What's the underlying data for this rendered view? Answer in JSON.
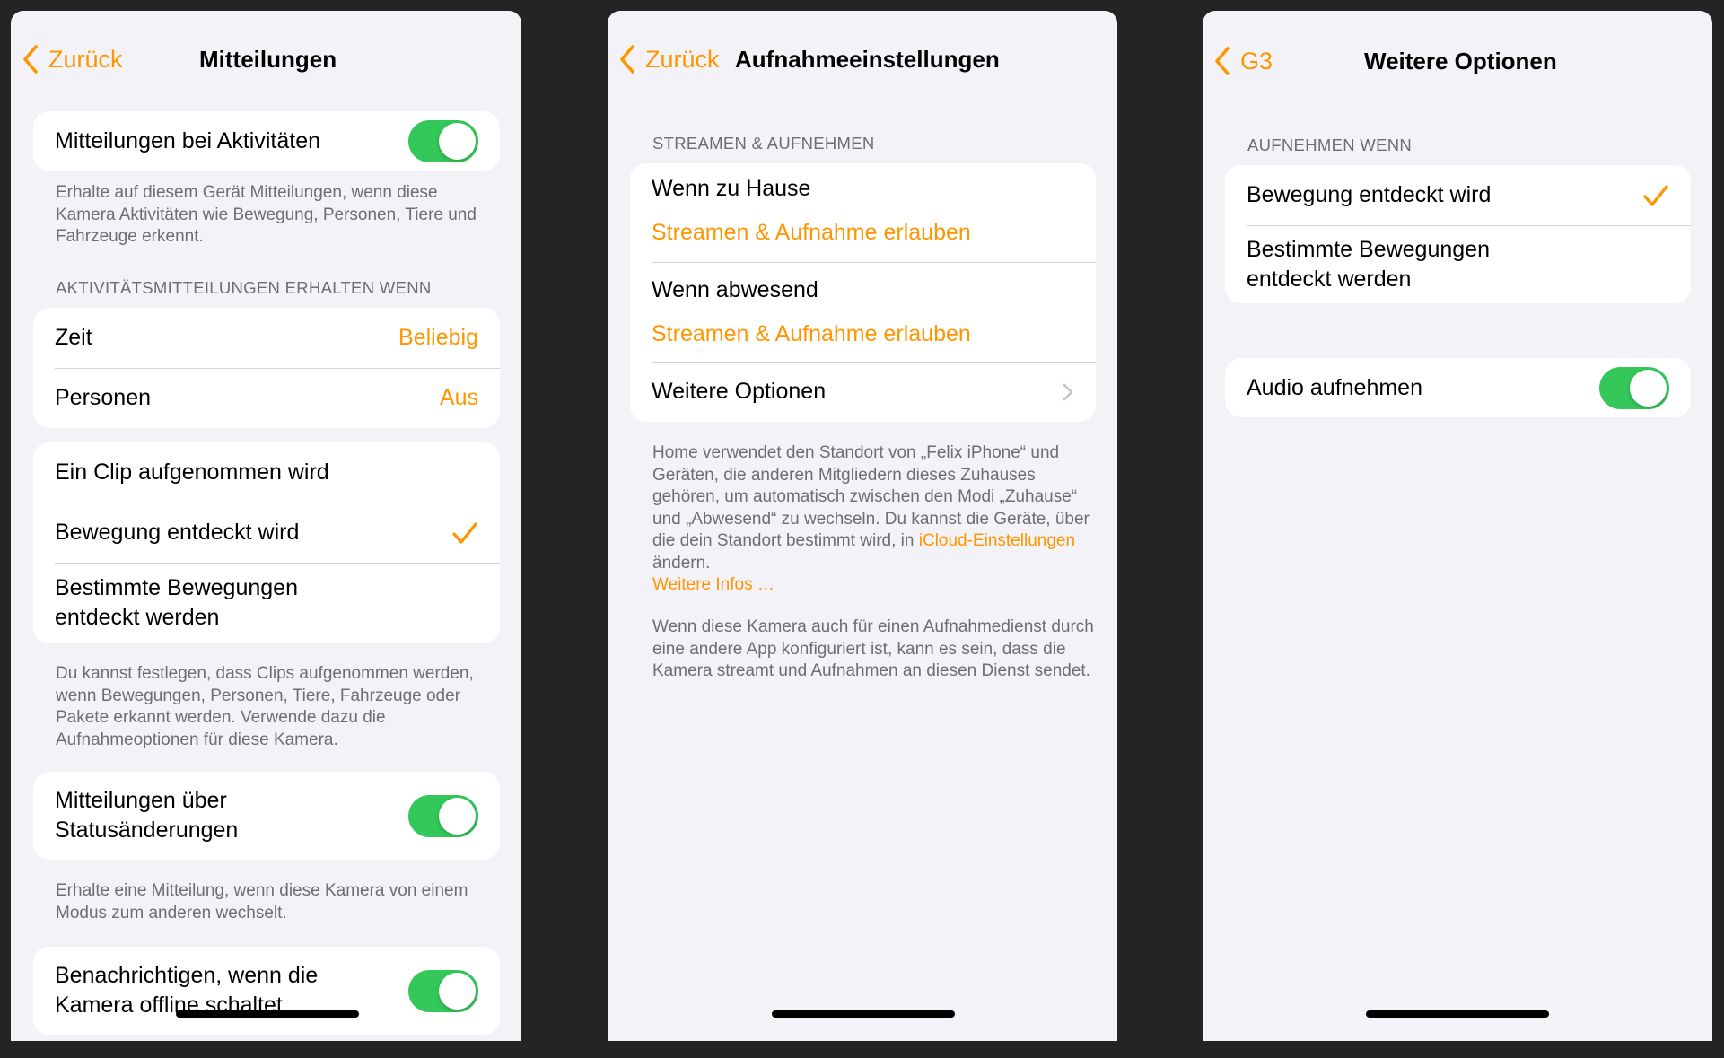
{
  "screen1": {
    "back_label": "Zurück",
    "title": "Mitteilungen",
    "activity_toggle_label": "Mitteilungen bei Aktivitäten",
    "activity_footnote": "Erhalte auf diesem Gerät Mitteilungen, wenn diese Kamera Aktivitäten wie Bewegung, Personen, Tiere und Fahrzeuge erkennt.",
    "section_when": "AKTIVITÄTSMITTEILUNGEN ERHALTEN WENN",
    "time_label": "Zeit",
    "time_value": "Beliebig",
    "persons_label": "Personen",
    "persons_value": "Aus",
    "clip_option": "Ein Clip aufgenommen wird",
    "motion_option": "Bewegung entdeckt wird",
    "specific_motion_line1": "Bestimmte Bewegungen",
    "specific_motion_line2": "entdeckt werden",
    "clips_footnote": "Du kannst festlegen, dass Clips aufgenommen werden, wenn Bewegungen, Personen, Tiere, Fahrzeuge oder Pakete erkannt werden. Verwende dazu die Aufnahmeoptionen für diese Kamera.",
    "status_line1": "Mitteilungen über",
    "status_line2": "Statusänderungen",
    "status_footnote": "Erhalte eine Mitteilung, wenn diese Kamera von einem Modus zum anderen wechselt.",
    "offline_line1": "Benachrichtigen, wenn die",
    "offline_line2": "Kamera offline schaltet"
  },
  "screen2": {
    "back_label": "Zurück",
    "title": "Aufnahmeeinstellungen",
    "section": "STREAMEN & AUFNEHMEN",
    "home_label": "Wenn zu Hause",
    "home_value": "Streamen & Aufnahme erlauben",
    "away_label": "Wenn abwesend",
    "away_value": "Streamen & Aufnahme erlauben",
    "more_options": "Weitere Optionen",
    "footnote_text": "Home verwendet den Standort von „Felix iPhone“ und Geräten, die anderen Mitgliedern dieses Zuhauses gehören, um automatisch zwischen den Modi „Zuhause“ und „Abwesend“ zu wechseln. Du kannst die Geräte, über die dein Standort bestimmt wird, in",
    "footnote_link": "iCloud-Einstellungen",
    "footnote_after": "ändern.",
    "more_info_link": "Weitere Infos …",
    "service_footnote": "Wenn diese Kamera auch für einen Aufnahmedienst durch eine andere App konfiguriert ist, kann es sein, dass die Kamera streamt und Aufnahmen an diesen Dienst sendet."
  },
  "screen3": {
    "back_label": "G3",
    "title": "Weitere Optionen",
    "section": "AUFNEHMEN WENN",
    "motion_option": "Bewegung entdeckt wird",
    "specific_motion_line1": "Bestimmte Bewegungen",
    "specific_motion_line2": "entdeckt werden",
    "audio_label": "Audio aufnehmen"
  }
}
